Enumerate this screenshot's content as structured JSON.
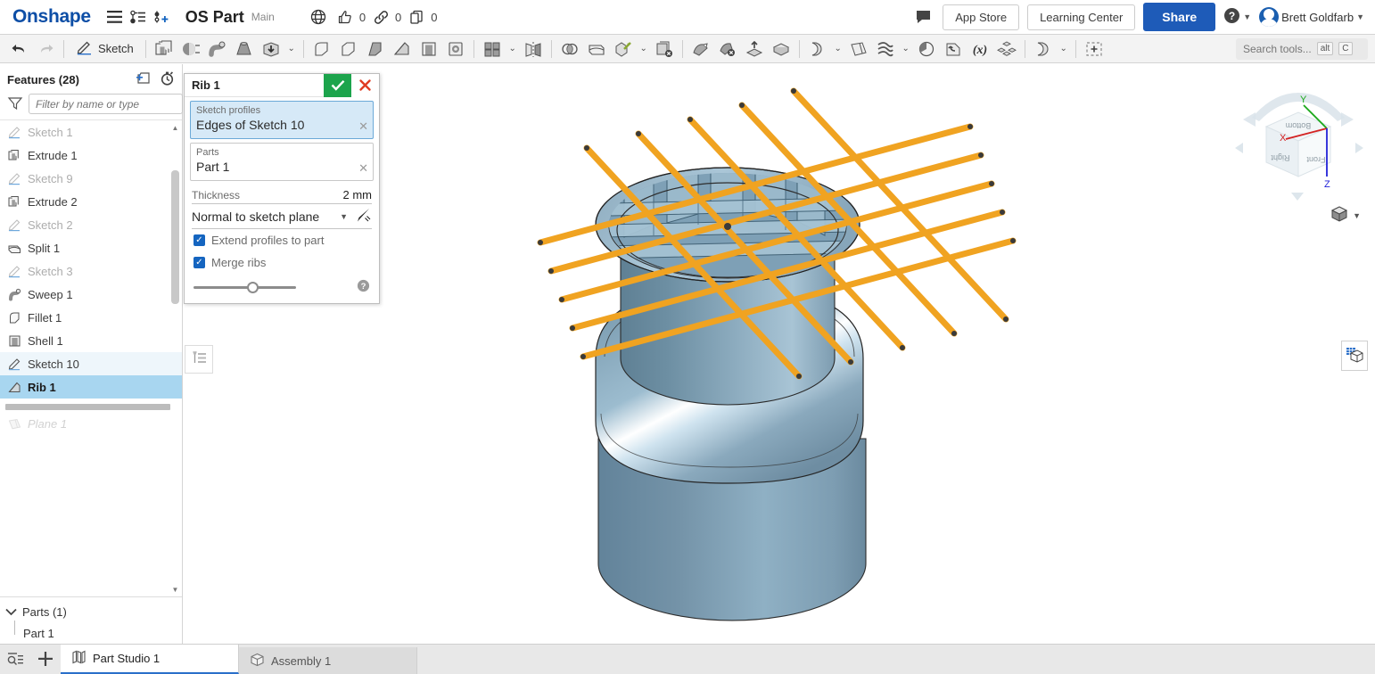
{
  "topbar": {
    "logo": "Onshape",
    "menu_icon": "hamburger-menu-icon",
    "versions_icon": "version-graph-icon",
    "branch_icon": "add-version-icon",
    "doc_title": "OS Part",
    "branch": "Main",
    "globe_icon": "globe-public-icon",
    "like_icon": "thumbs-up-icon",
    "like_count": "0",
    "link_icon": "link-icon",
    "link_count": "0",
    "copy_icon": "copy-icon",
    "copy_count": "0",
    "comment_icon": "comment-bubble-icon",
    "app_store": "App Store",
    "learning_center": "Learning Center",
    "share": "Share",
    "help_icon": "help-circle-icon",
    "username": "Brett Goldfarb"
  },
  "toolbar": {
    "undo_icon": "undo-arrow-icon",
    "redo_icon": "redo-arrow-icon",
    "sketch_label": "Sketch",
    "sketch_icon": "pencil-sketch-icon",
    "tools": [
      {
        "name": "extrude-icon"
      },
      {
        "name": "revolve-icon"
      },
      {
        "name": "sweep-icon"
      },
      {
        "name": "loft-icon"
      },
      {
        "name": "thicken-icon"
      },
      {
        "name": "fillet-icon"
      },
      {
        "name": "chamfer-icon"
      },
      {
        "name": "draft-icon"
      },
      {
        "name": "rib-icon"
      },
      {
        "name": "shell-icon"
      },
      {
        "name": "hole-icon"
      },
      {
        "name": "linear-pattern-icon"
      },
      {
        "name": "mirror-icon"
      },
      {
        "name": "boolean-icon"
      },
      {
        "name": "split-icon"
      },
      {
        "name": "transform-icon"
      },
      {
        "name": "delete-face-icon"
      },
      {
        "name": "move-face-icon"
      },
      {
        "name": "delete-part-icon"
      },
      {
        "name": "replace-face-icon"
      },
      {
        "name": "enclose-icon"
      },
      {
        "name": "sheet-metal-icon"
      },
      {
        "name": "plane-icon"
      },
      {
        "name": "curve-icon"
      },
      {
        "name": "mass-properties-icon"
      },
      {
        "name": "import-derived-icon"
      },
      {
        "name": "variable-icon"
      },
      {
        "name": "composite-part-icon"
      },
      {
        "name": "assembly-feature-icon"
      },
      {
        "name": "custom-feature-icon"
      }
    ],
    "search_placeholder": "Search tools...",
    "search_kbd_alt": "alt",
    "search_kbd_key": "C"
  },
  "features_panel": {
    "title": "Features (28)",
    "folder_icon": "new-folder-icon",
    "history_icon": "history-clock-icon",
    "filter_icon": "funnel-filter-icon",
    "filter_placeholder": "Filter by name or type",
    "items": [
      {
        "label": "Sketch 1",
        "icon": "sketch-icon",
        "state": "dim"
      },
      {
        "label": "Extrude 1",
        "icon": "extrude-icon",
        "state": "normal"
      },
      {
        "label": "Sketch 9",
        "icon": "sketch-icon",
        "state": "dim"
      },
      {
        "label": "Extrude 2",
        "icon": "extrude-icon",
        "state": "normal"
      },
      {
        "label": "Sketch 2",
        "icon": "sketch-icon",
        "state": "dim"
      },
      {
        "label": "Split 1",
        "icon": "split-icon",
        "state": "normal"
      },
      {
        "label": "Sketch 3",
        "icon": "sketch-icon",
        "state": "dim"
      },
      {
        "label": "Sweep 1",
        "icon": "sweep-icon",
        "state": "normal"
      },
      {
        "label": "Fillet 1",
        "icon": "fillet-icon",
        "state": "normal"
      },
      {
        "label": "Shell 1",
        "icon": "shell-icon",
        "state": "normal"
      },
      {
        "label": "Sketch 10",
        "icon": "sketch-icon",
        "state": "highlight"
      },
      {
        "label": "Rib 1",
        "icon": "rib-icon",
        "state": "selected"
      }
    ],
    "rolled_back": [
      {
        "label": "Plane 1",
        "icon": "plane-icon",
        "state": "rolledback"
      }
    ],
    "parts_title": "Parts (1)",
    "parts": [
      {
        "label": "Part 1"
      }
    ]
  },
  "rib_dialog": {
    "title": "Rib 1",
    "ok_icon": "checkmark-icon",
    "cancel_icon": "x-close-icon",
    "sketch_profiles_label": "Sketch profiles",
    "sketch_profiles_value": "Edges of Sketch 10",
    "parts_label": "Parts",
    "parts_value": "Part 1",
    "thickness_label": "Thickness",
    "thickness_value": "2 mm",
    "direction_value": "Normal to sketch plane",
    "direction_icon": "flip-direction-arrow-icon",
    "extend_label": "Extend profiles to part",
    "extend_checked": true,
    "merge_label": "Merge ribs",
    "merge_checked": true,
    "help_icon": "question-circle-icon",
    "list_panel_icon": "feature-list-panel-icon"
  },
  "viewport": {
    "cube_labels": {
      "top": "Bottom",
      "left": "Right",
      "front": "Front"
    },
    "axes": {
      "x": "X",
      "y": "Y",
      "z": "Z"
    },
    "axis_colors": {
      "x": "#d32222",
      "y": "#1aa81a",
      "z": "#2222d8"
    },
    "view_mode_icon": "shaded-view-icon",
    "right_panel_icon": "display-panel-icon",
    "model_colors": {
      "body_light": "#a9c3d4",
      "body_mid": "#7fa0b4",
      "body_dark": "#5e7f92",
      "rib_face": "#9bb8cb",
      "sketch_orange": "#f0a321"
    }
  },
  "tabbar": {
    "sheets_icon": "tab-list-icon",
    "add_icon": "plus-add-tab-icon",
    "tabs": [
      {
        "label": "Part Studio 1",
        "icon": "part-studio-icon",
        "active": true
      },
      {
        "label": "Assembly 1",
        "icon": "assembly-icon",
        "active": false
      }
    ]
  }
}
